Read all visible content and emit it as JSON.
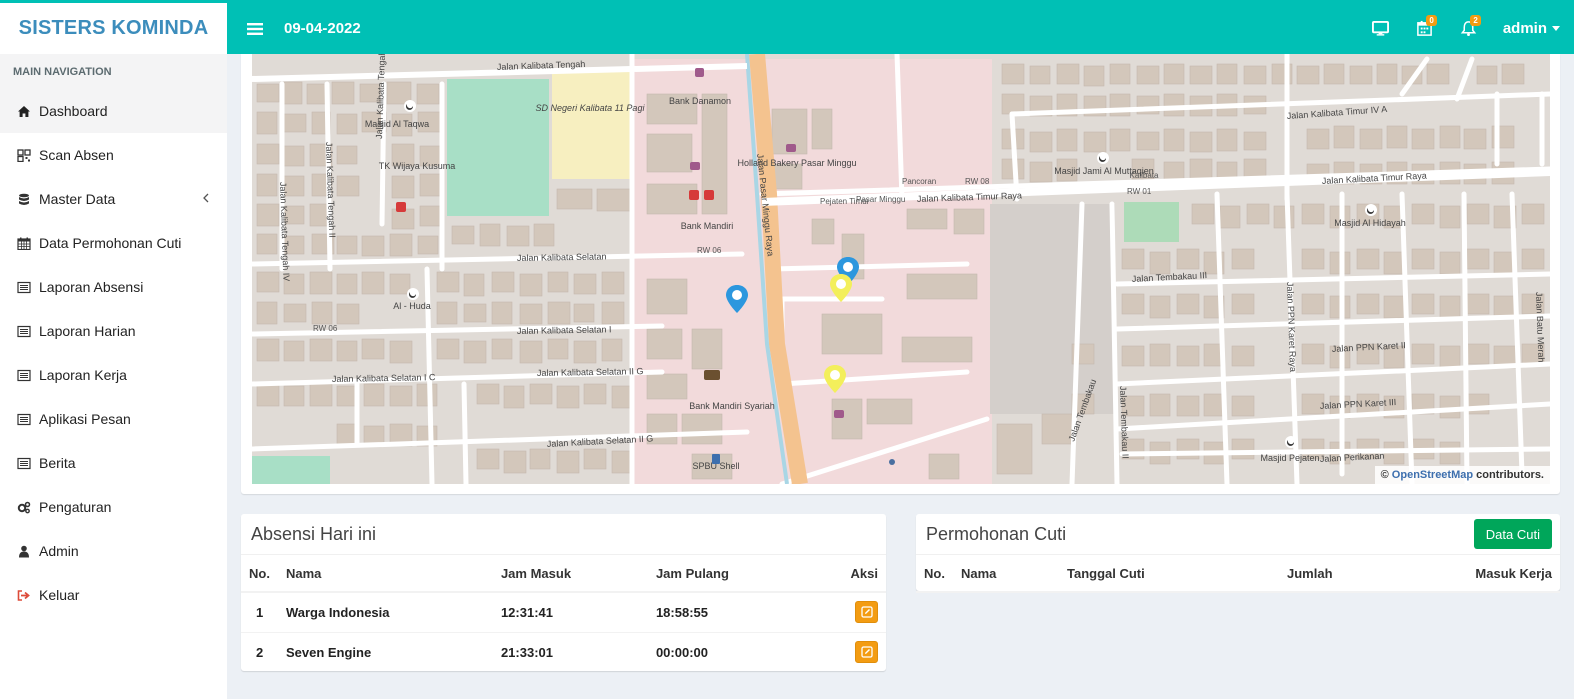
{
  "app": {
    "brand": "SISTERS KOMINDA"
  },
  "header": {
    "date": "09-04-2022",
    "calendar_badge": "0",
    "bell_badge": "2",
    "user": "admin"
  },
  "sidebar": {
    "section": "MAIN NAVIGATION",
    "items": [
      {
        "label": "Dashboard",
        "icon": "home-icon"
      },
      {
        "label": "Scan Absen",
        "icon": "qrcode-icon"
      },
      {
        "label": "Master Data",
        "icon": "database-icon"
      },
      {
        "label": "Data Permohonan Cuti",
        "icon": "calendar-icon"
      },
      {
        "label": "Laporan Absensi",
        "icon": "list-alt-icon"
      },
      {
        "label": "Laporan Harian",
        "icon": "list-alt-icon"
      },
      {
        "label": "Laporan Kerja",
        "icon": "list-alt-icon"
      },
      {
        "label": "Aplikasi Pesan",
        "icon": "list-alt-icon"
      },
      {
        "label": "Berita",
        "icon": "list-alt-icon"
      },
      {
        "label": "Pengaturan",
        "icon": "cogs-icon"
      },
      {
        "label": "Admin",
        "icon": "user-icon"
      },
      {
        "label": "Keluar",
        "icon": "sign-out-icon"
      }
    ]
  },
  "map": {
    "attribution_prefix": "©",
    "attribution_link": "OpenStreetMap",
    "attribution_suffix": "contributors.",
    "labels": {
      "jalan_kalibata_tengah": "Jalan Kalibata Tengah",
      "masjid_al_taqwa": "Masjid Al Taqwa",
      "tk_wijaya_kusuma": "TK Wijaya Kusuma",
      "sd_negeri": "SD Negeri Kalibata 11 Pagi",
      "bank_danamon": "Bank Danamon",
      "bank_mandiri": "Bank Mandiri",
      "holland_bakery": "Holland Bakery Pasar Minggu",
      "jalan_pasar_minggu_raya": "Jalan Pasar Minggu Raya",
      "jalan_kalibata_timur_raya": "Jalan Kalibata Timur Raya",
      "jalan_kalibata_timur_iv_a": "Jalan Kalibata Timur IV A",
      "masjid_jami": "Masjid Jami Al Muttaqien",
      "kalibata": "Kalibata",
      "masjid_al_hidayah": "Masjid Al Hidayah",
      "jalan_kalibata_selatan": "Jalan Kalibata Selatan",
      "jalan_kalibata_selatan_i": "Jalan Kalibata Selatan I",
      "jalan_kalibata_selatan_ic": "Jalan Kalibata Selatan I C",
      "jalan_kalibata_selatan_iig": "Jalan Kalibata Selatan II G",
      "al_huda": "Al - Huda",
      "jalan_tembakau_iii": "Jalan Tembakau III",
      "jalan_ppn_karet_ii": "Jalan PPN Karet II",
      "jalan_ppn_karet_iii": "Jalan PPN Karet III",
      "jalan_perikanan": "Jalan Perikanan",
      "masjid_pejaten": "Masjid Pejaten",
      "bank_mandiri_syariah": "Bank Mandiri Syariah",
      "spbu_shell": "SPBU Shell",
      "jalan_tembakau": "Jalan Tembakau",
      "jalan_tembakau_ii": "Jalan Tembakau II",
      "jalan_batu_merah": "Jalan Batu Merah",
      "rw_06": "RW 06",
      "rw_08": "RW 08",
      "rw_01": "RW 01",
      "pejaten_timur": "Pejaten Timur",
      "pasar_minggu": "Pasar Minggu",
      "pancoran": "Pancoran",
      "jalan_kalibata_tengah_iv": "Jalan Kalibata Tengah IV",
      "jalan_kalibata_tengah_ii": "Jalan Kalibata Tengah II",
      "jalan_kalibata_tengah_i": "Jalan Kalibata Tengah I",
      "jalan_ppn_karet_raya": "Jalan PPN Karet Raya"
    }
  },
  "absensi": {
    "title": "Absensi Hari ini",
    "columns": [
      "No.",
      "Nama",
      "Jam Masuk",
      "Jam Pulang",
      "Aksi"
    ],
    "rows": [
      {
        "no": "1",
        "nama": "Warga Indonesia",
        "masuk": "12:31:41",
        "pulang": "18:58:55"
      },
      {
        "no": "2",
        "nama": "Seven Engine",
        "masuk": "21:33:01",
        "pulang": "00:00:00"
      }
    ]
  },
  "cuti": {
    "title": "Permohonan Cuti",
    "button": "Data Cuti",
    "columns": [
      "No.",
      "Nama",
      "Tanggal Cuti",
      "Jumlah",
      "Masuk Kerja"
    ]
  },
  "colors": {
    "header": "#00c0b5",
    "brand": "#3c8dbc",
    "success": "#00a65a",
    "warning": "#f39c12"
  }
}
